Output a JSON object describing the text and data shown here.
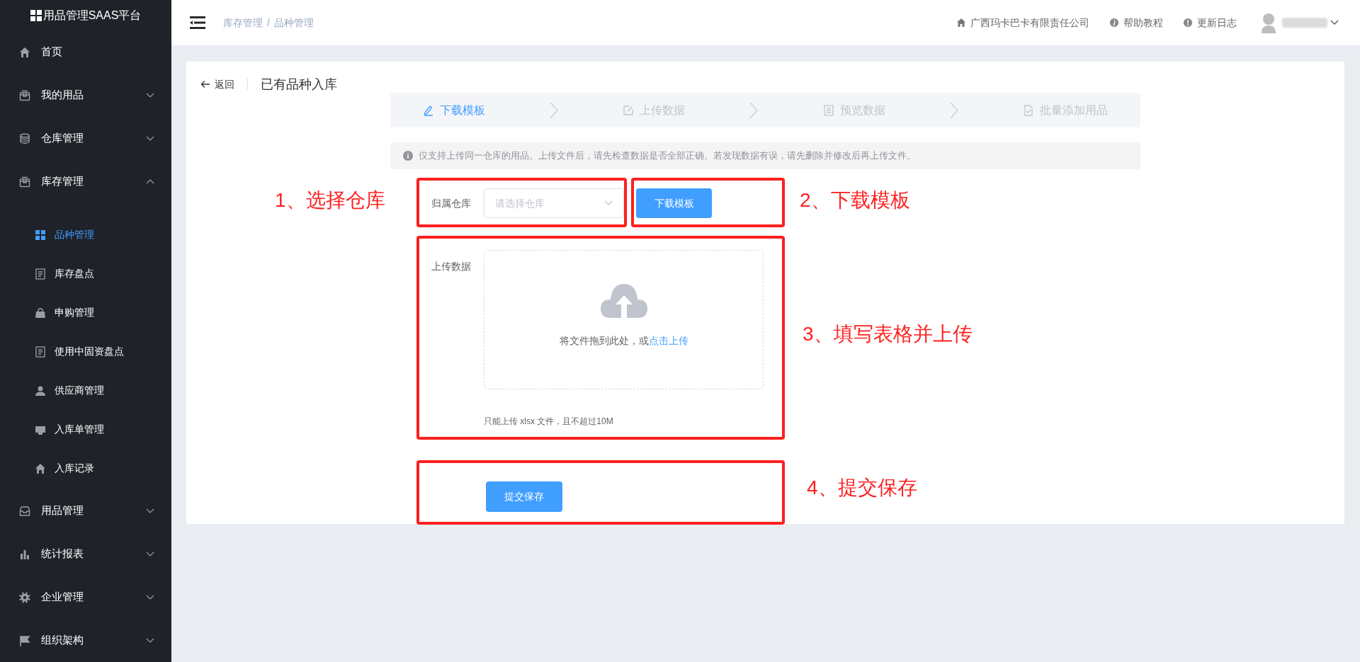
{
  "sidebar": {
    "logo": "用品管理SAAS平台",
    "items": [
      {
        "label": "首页",
        "kind": "link"
      },
      {
        "label": "我的用品",
        "kind": "group",
        "expanded": false
      },
      {
        "label": "仓库管理",
        "kind": "group",
        "expanded": false
      },
      {
        "label": "库存管理",
        "kind": "group",
        "expanded": true,
        "children": [
          {
            "label": "品种管理",
            "selected": true
          },
          {
            "label": "库存盘点",
            "selected": false
          },
          {
            "label": "申购管理",
            "selected": false
          },
          {
            "label": "使用中固资盘点",
            "selected": false
          },
          {
            "label": "供应商管理",
            "selected": false
          },
          {
            "label": "入库单管理",
            "selected": false
          },
          {
            "label": "入库记录",
            "selected": false
          }
        ]
      },
      {
        "label": "用品管理",
        "kind": "group",
        "expanded": false
      },
      {
        "label": "统计报表",
        "kind": "group",
        "expanded": false
      },
      {
        "label": "企业管理",
        "kind": "group",
        "expanded": false
      },
      {
        "label": "组织架构",
        "kind": "group",
        "expanded": false
      }
    ]
  },
  "header": {
    "breadcrumb": {
      "items": [
        "库存管理",
        "品种管理"
      ],
      "separator": "/"
    },
    "company": "广西玛卡巴卡有限责任公司",
    "links": [
      "帮助教程",
      "更新日志"
    ]
  },
  "page": {
    "back": "返回",
    "title": "已有品种入库",
    "steps": [
      {
        "label": "下载模板",
        "selected": true
      },
      {
        "label": "上传数据",
        "selected": false
      },
      {
        "label": "预览数据",
        "selected": false
      },
      {
        "label": "批量添加用品",
        "selected": false
      }
    ],
    "notice": "仅支持上传同一仓库的用品。上传文件后，请先检查数据是否全部正确。若发现数据有误，请先删除并修改后再上传文件。",
    "form": {
      "warehouse_label": "归属仓库",
      "warehouse_placeholder": "请选择仓库",
      "download_button": "下载模板",
      "upload_label": "上传数据",
      "upload_text": "将文件拖到此处，或",
      "upload_link": "点击上传",
      "upload_hint": "只能上传 xlsx 文件，且不超过10M",
      "submit_button": "提交保存"
    }
  },
  "annotations": [
    "1、选择仓库",
    "2、下载模板",
    "3、填写表格并上传",
    "4、提交保存"
  ]
}
